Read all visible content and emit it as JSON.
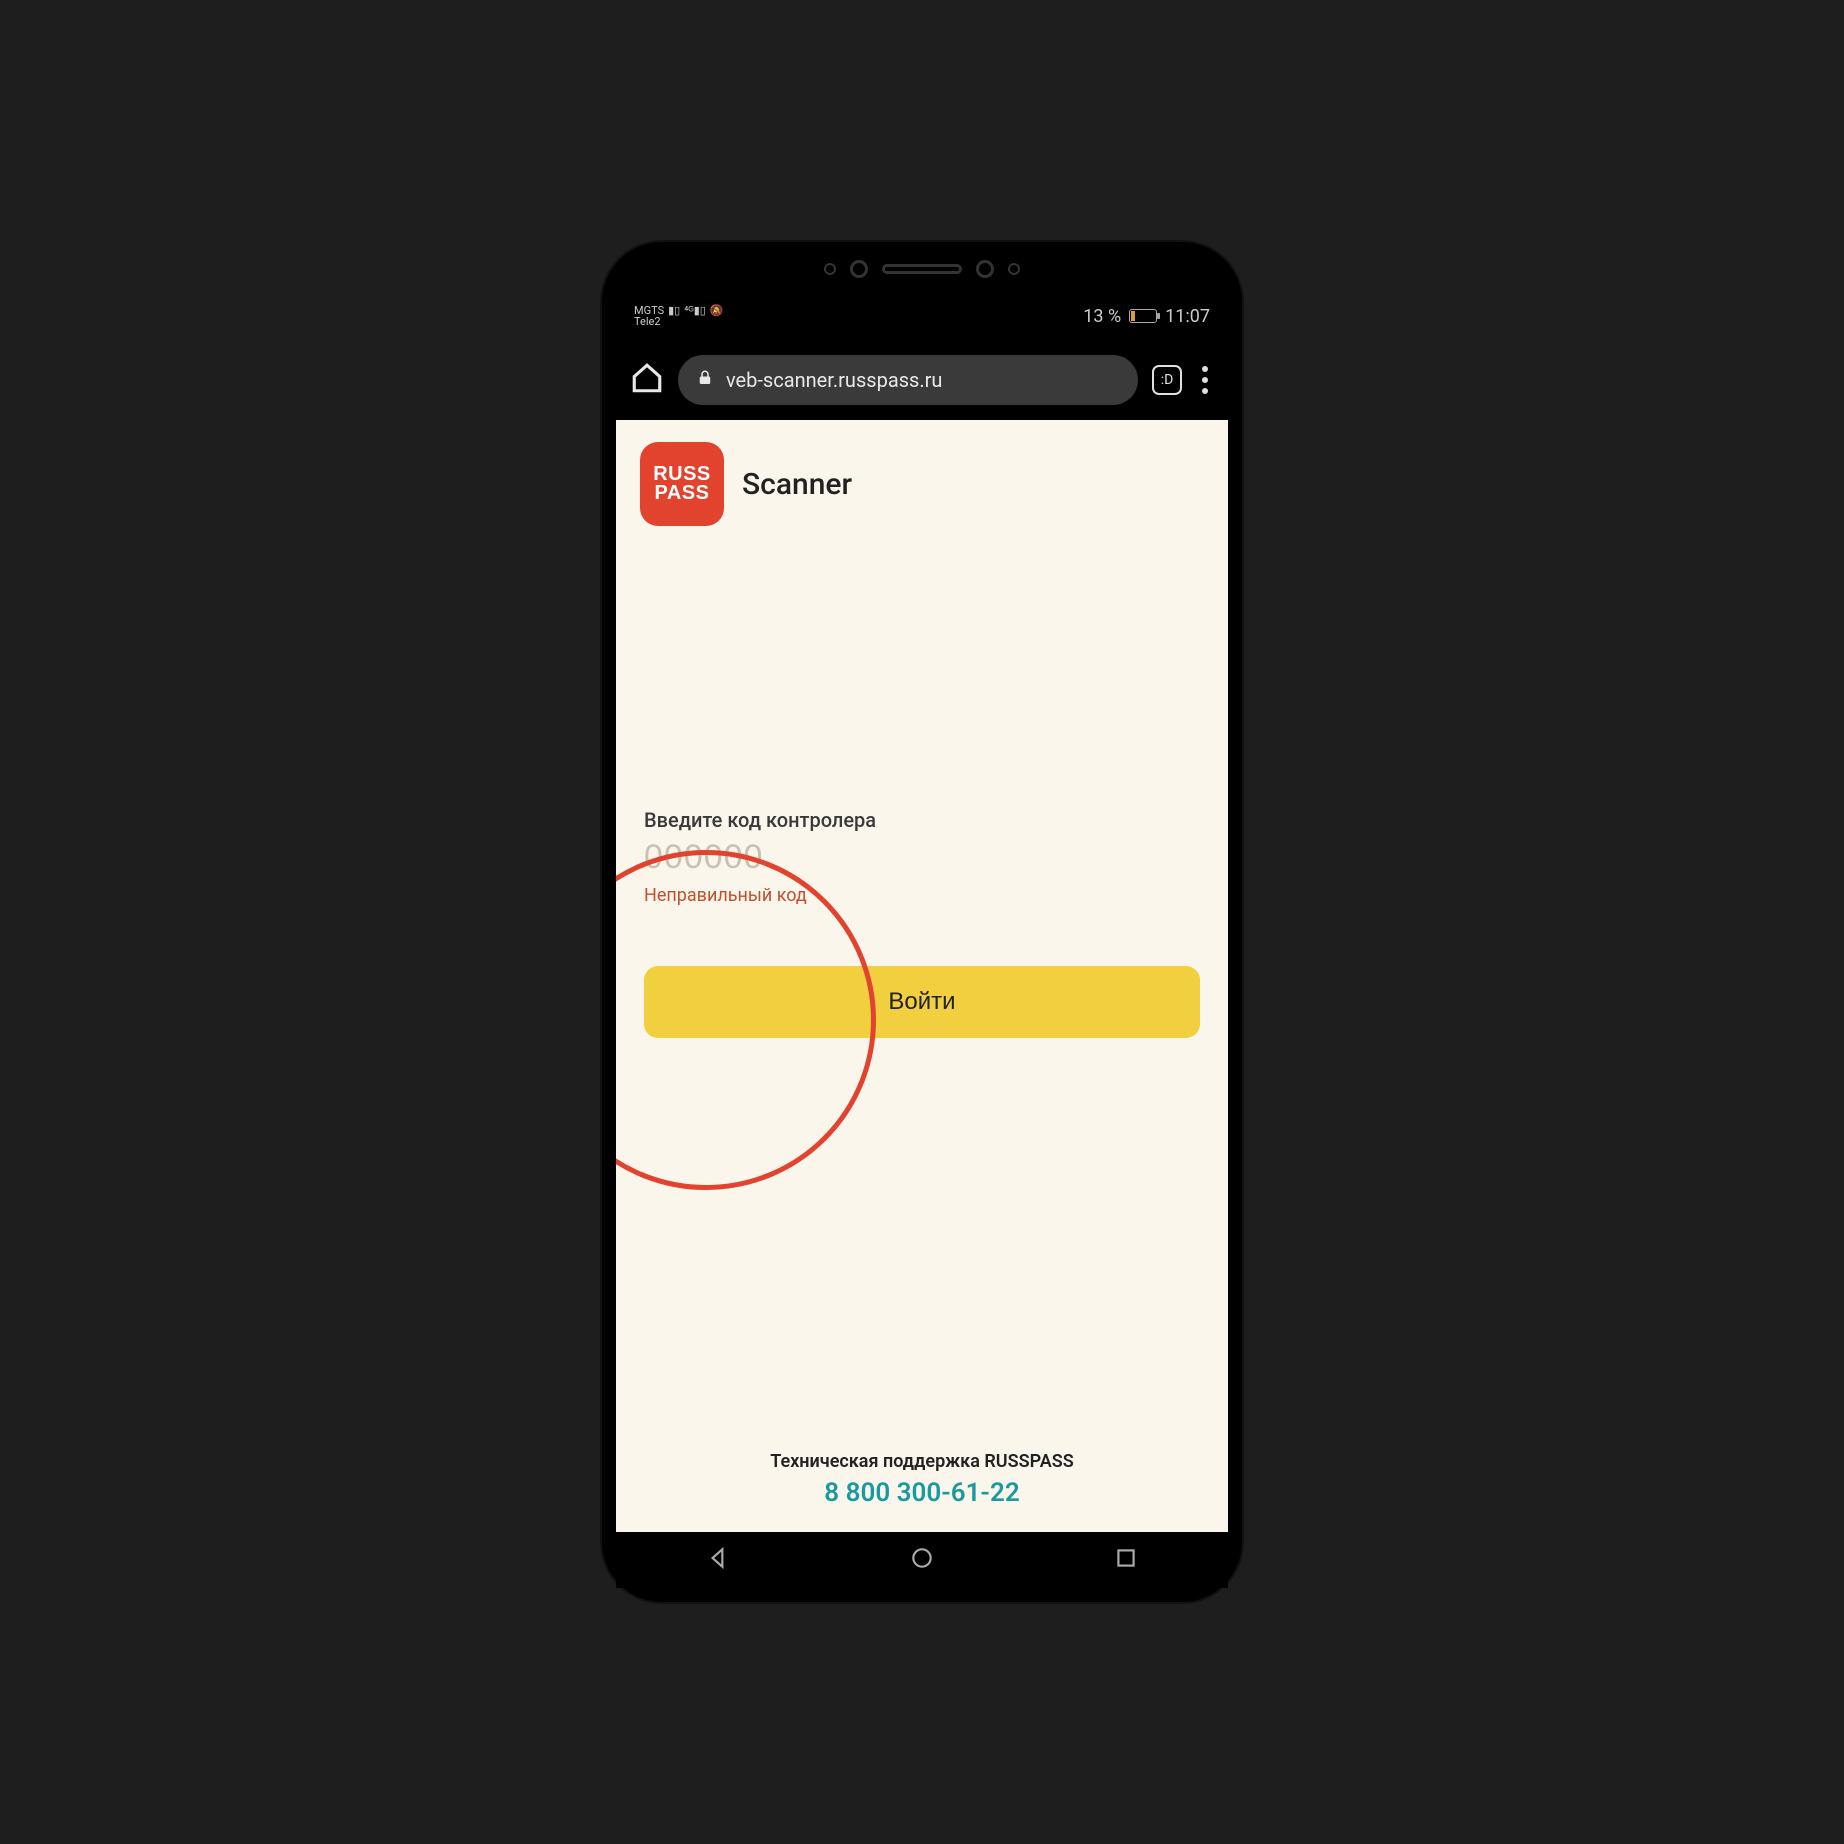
{
  "status": {
    "carrier1": "MGTS",
    "carrier2": "Tele2",
    "battery_text": "13 %",
    "time": "11:07"
  },
  "browser": {
    "url": "veb-scanner.russpass.ru"
  },
  "app": {
    "logo_line1": "RUSS",
    "logo_line2": "PASS",
    "title": "Scanner"
  },
  "form": {
    "label": "Введите код контролера",
    "placeholder": "000000",
    "error": "Неправильный код",
    "submit": "Войти"
  },
  "support": {
    "label": "Техническая поддержка RUSSPASS",
    "phone": "8 800 300-61-22"
  },
  "colors": {
    "accent_red": "#e2432f",
    "accent_yellow": "#f2cf3f",
    "accent_teal": "#1a9aa0",
    "page_bg": "#faf6ec"
  }
}
